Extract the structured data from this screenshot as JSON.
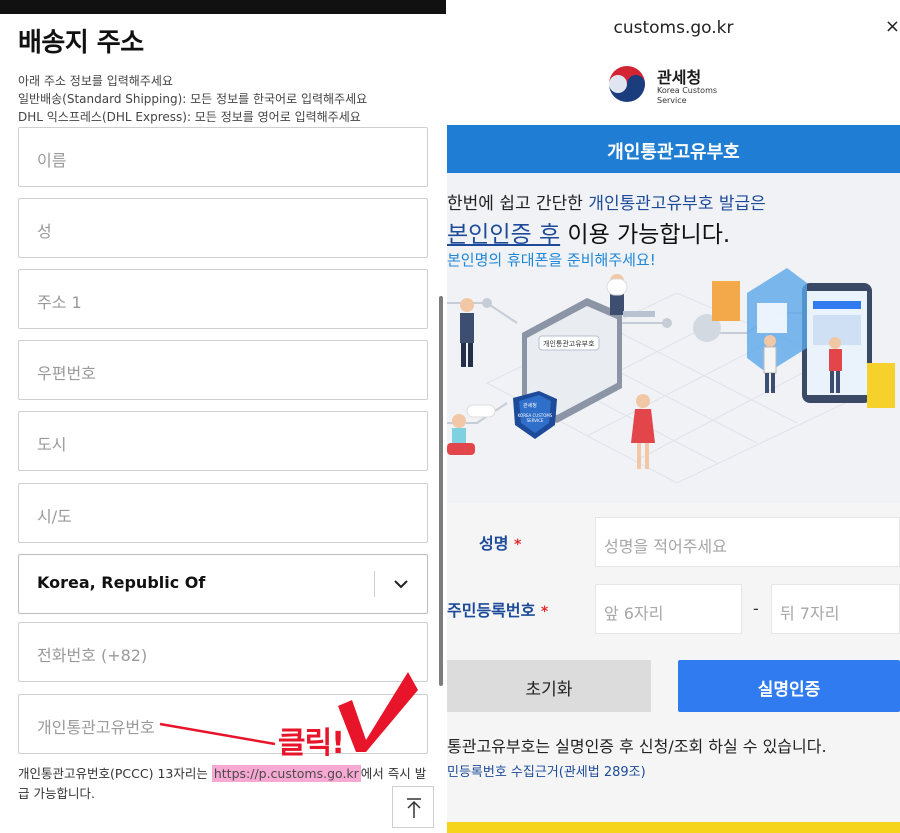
{
  "left": {
    "title": "배송지 주소",
    "notes": [
      "아래 주소 정보를 입력해주세요",
      "일반배송(Standard Shipping): 모든 정보를 한국어로 입력해주세요",
      "DHL 익스프레스(DHL Express): 모든 정보를 영어로 입력해주세요"
    ],
    "fields": {
      "first_name": "이름",
      "last_name": "성",
      "address1": "주소 1",
      "postal_code": "우편번호",
      "city": "도시",
      "province": "시/도",
      "phone": "전화번호 (+82)",
      "pccc": "개인통관고유번호"
    },
    "country": {
      "value": "Korea, Republic Of"
    },
    "pccc_note": {
      "prefix": "개인통관고유번호(PCCC) 13자리는 ",
      "link": "https://p.customs.go.kr",
      "suffix": "에서 즉시 발급 가능합니다."
    },
    "annotation": {
      "text": "클릭!",
      "color": "#e8142a"
    }
  },
  "right": {
    "url": "customs.go.kr",
    "close": "×",
    "brand": {
      "name": "관세청",
      "sub1": "Korea Customs",
      "sub2": "Service"
    },
    "band_title": "개인통관고유부호",
    "hero": {
      "line1_a": "한번에 쉽고 간단한 ",
      "line1_b": "개인통관고유부호 발급은",
      "line2_a": "본인인증 후",
      "line2_b": " 이용 가능합니다.",
      "line3": "본인명의 휴대폰을 준비해주세요!",
      "badge_top": "관세청",
      "badge_bottom": "KOREA CUSTOMS SERVICE",
      "card_label": "개인통관고유부호"
    },
    "form": {
      "name_label": "성명",
      "name_placeholder": "성명을 적어주세요",
      "rrn_label": "주민등록번호",
      "rrn_front_placeholder": "앞 6자리",
      "rrn_back_placeholder": "뒤 7자리",
      "required_mark": "*",
      "dash": "-"
    },
    "buttons": {
      "reset": "초기화",
      "verify": "실명인증"
    },
    "info1": "통관고유부호는 실명인증 후 신청/조회 하실 수 있습니다.",
    "info2": "민등록번호 수집근거(관세법 289조)",
    "colors": {
      "primary": "#1f7ed3",
      "button": "#2f7bef",
      "accent": "#f5d41a"
    }
  }
}
